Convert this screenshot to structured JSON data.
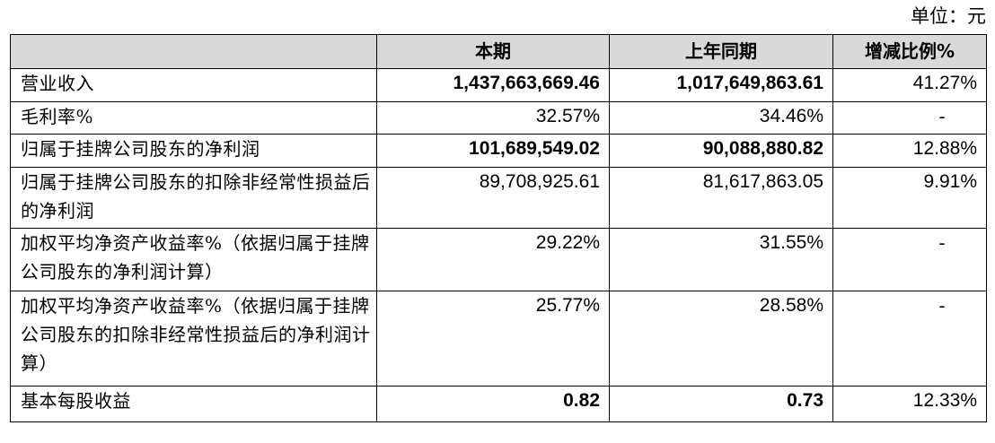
{
  "unit_label": "单位：元",
  "header": {
    "col_item": "",
    "col_current": "本期",
    "col_prior": "上年同期",
    "col_change": "增减比例%"
  },
  "rows": [
    {
      "label": "营业收入",
      "current": "1,437,663,669.46",
      "prior": "1,017,649,863.61",
      "change": "41.27%"
    },
    {
      "label": "毛利率%",
      "current": "32.57%",
      "prior": "34.46%",
      "change": "-"
    },
    {
      "label": "归属于挂牌公司股东的净利润",
      "current": "101,689,549.02",
      "prior": "90,088,880.82",
      "change": "12.88%"
    },
    {
      "label": "归属于挂牌公司股东的扣除非经常性损益后的净利润",
      "current": "89,708,925.61",
      "prior": "81,617,863.05",
      "change": "9.91%"
    },
    {
      "label": "加权平均净资产收益率%（依据归属于挂牌公司股东的净利润计算）",
      "current": "29.22%",
      "prior": "31.55%",
      "change": "-"
    },
    {
      "label": "加权平均净资产收益率%（依据归属于挂牌公司股东的扣除非经常性损益后的净利润计算）",
      "current": "25.77%",
      "prior": "28.58%",
      "change": "-"
    },
    {
      "label": "基本每股收益",
      "current": "0.82",
      "prior": "0.73",
      "change": "12.33%"
    }
  ]
}
